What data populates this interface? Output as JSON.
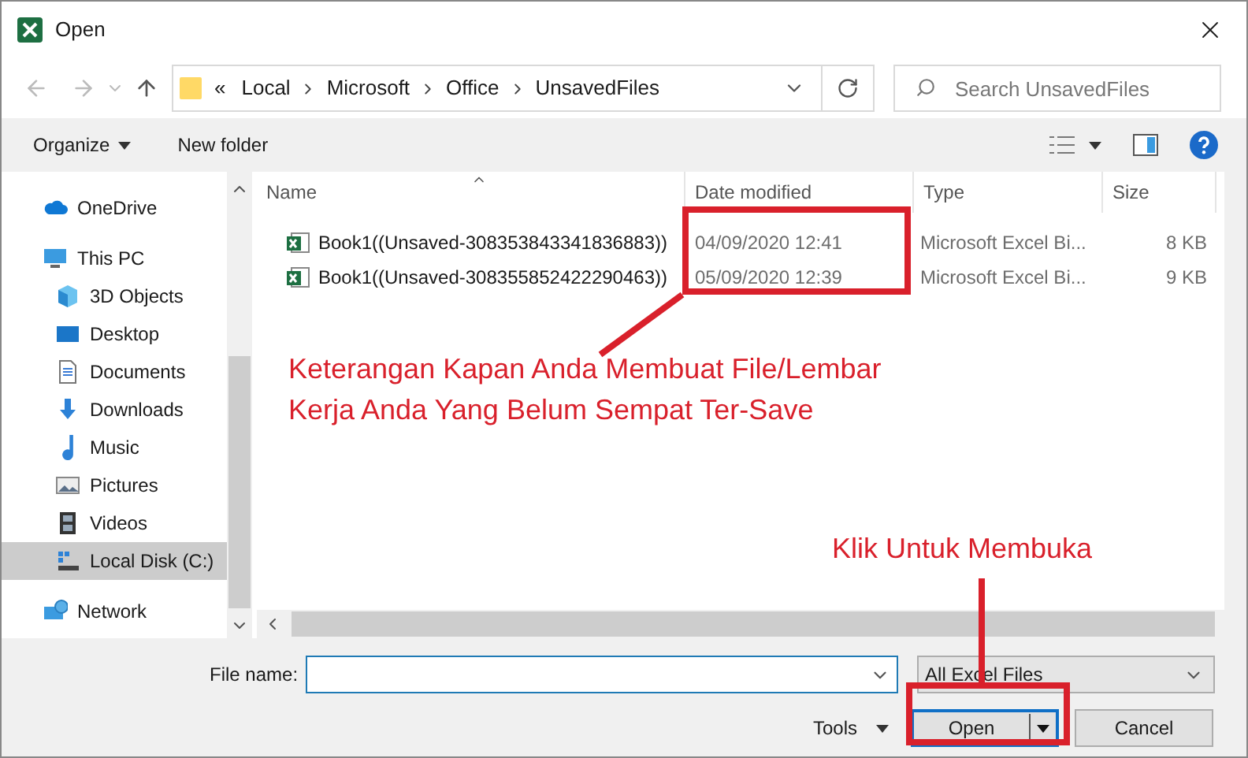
{
  "window": {
    "title": "Open"
  },
  "address": {
    "prefix": "«",
    "crumbs": [
      "Local",
      "Microsoft",
      "Office",
      "UnsavedFiles"
    ]
  },
  "search": {
    "placeholder": "Search UnsavedFiles"
  },
  "toolbar": {
    "organize": "Organize",
    "new_folder": "New folder"
  },
  "sidebar": {
    "items": [
      {
        "label": "OneDrive",
        "kind": "cloud",
        "selected": false
      },
      {
        "label": "This PC",
        "kind": "pc",
        "selected": false,
        "children": [
          {
            "label": "3D Objects",
            "kind": "cube",
            "selected": false
          },
          {
            "label": "Desktop",
            "kind": "desktop",
            "selected": false
          },
          {
            "label": "Documents",
            "kind": "doc",
            "selected": false
          },
          {
            "label": "Downloads",
            "kind": "download",
            "selected": false
          },
          {
            "label": "Music",
            "kind": "music",
            "selected": false
          },
          {
            "label": "Pictures",
            "kind": "pictures",
            "selected": false
          },
          {
            "label": "Videos",
            "kind": "video",
            "selected": false
          },
          {
            "label": "Local Disk (C:)",
            "kind": "disk",
            "selected": true
          }
        ]
      },
      {
        "label": "Network",
        "kind": "network",
        "selected": false
      }
    ]
  },
  "table": {
    "columns": [
      "Name",
      "Date modified",
      "Type",
      "Size"
    ],
    "rows": [
      {
        "name": "Book1((Unsaved-308353843341836883))",
        "date": "04/09/2020 12:41",
        "type": "Microsoft Excel Bi...",
        "size": "8 KB"
      },
      {
        "name": "Book1((Unsaved-308355852422290463))",
        "date": "05/09/2020 12:39",
        "type": "Microsoft Excel Bi...",
        "size": "9 KB"
      }
    ]
  },
  "footer": {
    "file_name_label": "File name:",
    "file_type": "All Excel Files",
    "tools": "Tools",
    "open": "Open",
    "cancel": "Cancel"
  },
  "annotations": {
    "dates_note": "Keterangan Kapan Anda Membuat File/Lembar Kerja Anda Yang Belum Sempat Ter-Save",
    "open_note": "Klik Untuk Membuka"
  }
}
